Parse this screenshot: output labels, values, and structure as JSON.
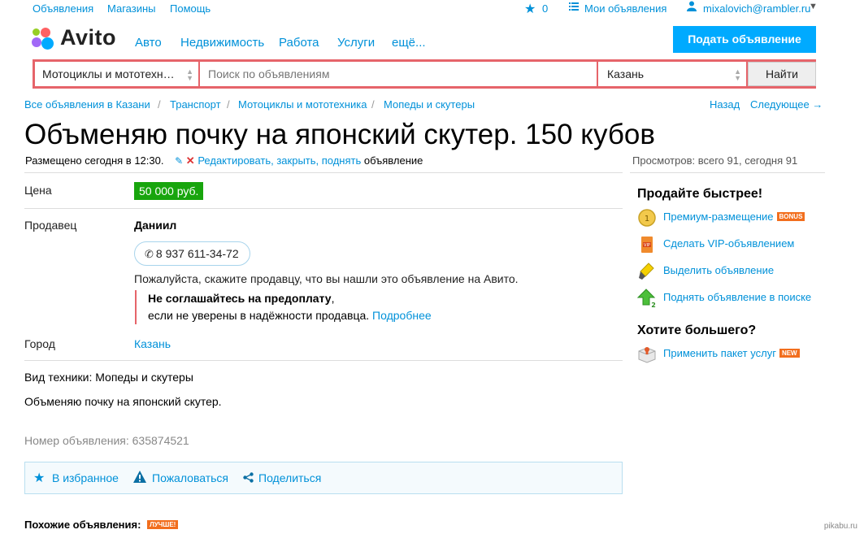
{
  "topbar": {
    "ads": "Объявления",
    "shops": "Магазины",
    "help": "Помощь",
    "fav_count": "0",
    "my_ads": "Мои объявления",
    "user": "mixalovich@rambler.ru"
  },
  "logo": {
    "text": "Avito"
  },
  "nav": {
    "items": [
      "Авто",
      "Недвижимость",
      "Работа",
      "Услуги",
      "ещё..."
    ],
    "post_button": "Подать объявление"
  },
  "search": {
    "category": "Мотоциклы и мототехн…",
    "placeholder": "Поиск по объявлениям",
    "city": "Казань",
    "button": "Найти"
  },
  "breadcrumbs": {
    "items": [
      "Все объявления в Казани",
      "Транспорт",
      "Мотоциклы и мототехника",
      "Мопеды и скутеры"
    ],
    "sep": "/",
    "back": "Назад",
    "next": "Следующее →"
  },
  "ad": {
    "title": "Объменяю почку на японский скутер. 150 кубов",
    "posted": "Размещено сегодня в 12:30.",
    "edit_link": "Редактировать, закрыть, поднять",
    "edit_suffix": "объявление",
    "views": "Просмотров: всего 91, сегодня 91",
    "price_label": "Цена",
    "price": "50 000 руб.",
    "seller_label": "Продавец",
    "seller": "Даниил",
    "phone": "8 937 611-34-72",
    "notice": "Пожалуйста, скажите продавцу, что вы нашли это объявление на Авито.",
    "warning_bold": "Не соглашайтесь на предоплату",
    "warning_comma": ",",
    "warning_text": "если не уверены в надёжности продавца.",
    "warning_link": "Подробнее",
    "city_label": "Город",
    "city": "Казань",
    "type": "Вид техники: Мопеды и скутеры",
    "description": "Объменяю почку на японский скутер.",
    "number": "Номер объявления: 635874521"
  },
  "actions": {
    "favorite": "В избранное",
    "report": "Пожаловаться",
    "share": "Поделиться"
  },
  "sidebar": {
    "sell_title": "Продайте быстрее!",
    "premium": "Премиум-размещение",
    "premium_badge": "BONUS",
    "vip": "Сделать VIP-объявлением",
    "highlight": "Выделить объявление",
    "raise": "Поднять объявление в поиске",
    "more_title": "Хотите большего?",
    "package": "Применить пакет услуг",
    "package_badge": "NEW"
  },
  "similar": {
    "title": "Похожие объявления:",
    "badge": "ЛУЧШЕ!"
  },
  "watermark": "pikabu.ru",
  "colors": {
    "link": "#0091d9",
    "price_bg": "#18a50d",
    "search_border": "#e6646a",
    "post_button": "#00aaff"
  }
}
